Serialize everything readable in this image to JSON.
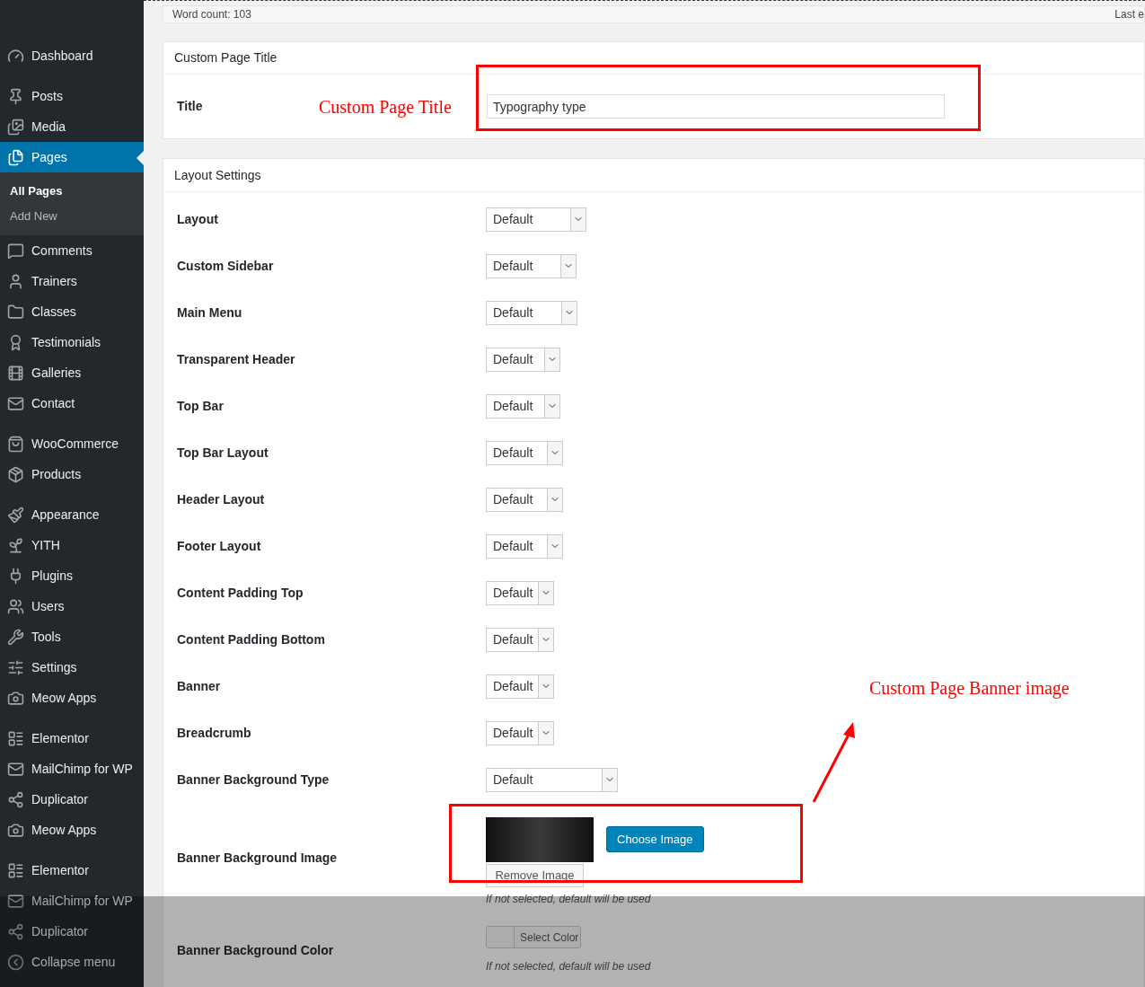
{
  "sidebar": {
    "groups": [
      [
        {
          "label": "Dashboard",
          "selected": false
        }
      ],
      [
        {
          "label": "Posts",
          "selected": false
        },
        {
          "label": "Media",
          "selected": false
        },
        {
          "label": "Pages",
          "selected": true,
          "children": [
            {
              "label": "All Pages",
              "selected": true
            },
            {
              "label": "Add New",
              "selected": false
            }
          ]
        },
        {
          "label": "Comments",
          "selected": false
        },
        {
          "label": "Trainers",
          "selected": false
        },
        {
          "label": "Classes",
          "selected": false
        },
        {
          "label": "Testimonials",
          "selected": false
        },
        {
          "label": "Galleries",
          "selected": false
        },
        {
          "label": "Contact",
          "selected": false
        }
      ],
      [
        {
          "label": "WooCommerce",
          "selected": false
        },
        {
          "label": "Products",
          "selected": false
        }
      ],
      [
        {
          "label": "Appearance",
          "selected": false
        },
        {
          "label": "YITH",
          "selected": false
        },
        {
          "label": "Plugins",
          "selected": false
        },
        {
          "label": "Users",
          "selected": false
        },
        {
          "label": "Tools",
          "selected": false
        },
        {
          "label": "Settings",
          "selected": false
        },
        {
          "label": "Meow Apps",
          "selected": false
        }
      ],
      [
        {
          "label": "Elementor",
          "selected": false
        },
        {
          "label": "MailChimp for WP",
          "selected": false
        },
        {
          "label": "Duplicator",
          "selected": false
        },
        {
          "label": "Meow Apps",
          "selected": false
        }
      ],
      [
        {
          "label": "Elementor",
          "selected": false
        },
        {
          "label": "MailChimp for WP",
          "selected": false
        },
        {
          "label": "Duplicator",
          "selected": false
        },
        {
          "label": "Collapse menu",
          "selected": false
        }
      ]
    ]
  },
  "status_bar": {
    "word_count": "Word count: 103",
    "last_edited": "Last e"
  },
  "custom_page_title": {
    "heading": "Custom Page Title",
    "label": "Title",
    "value": "Typography type"
  },
  "layout_settings": {
    "heading": "Layout Settings",
    "rows": [
      {
        "label": "Layout",
        "value": "Default"
      },
      {
        "label": "Custom Sidebar",
        "value": "Default"
      },
      {
        "label": "Main Menu",
        "value": "Default"
      },
      {
        "label": "Transparent Header",
        "value": "Default"
      },
      {
        "label": "Top Bar",
        "value": "Default"
      },
      {
        "label": "Top Bar Layout",
        "value": "Default"
      },
      {
        "label": "Header Layout",
        "value": "Default"
      },
      {
        "label": "Footer Layout",
        "value": "Default"
      },
      {
        "label": "Content Padding Top",
        "value": "Default"
      },
      {
        "label": "Content Padding Bottom",
        "value": "Default"
      },
      {
        "label": "Banner",
        "value": "Default"
      },
      {
        "label": "Breadcrumb",
        "value": "Default"
      },
      {
        "label": "Banner Background Type",
        "value": "Default"
      }
    ],
    "banner_image": {
      "label": "Banner Background Image",
      "choose_button": "Choose Image",
      "remove_button": "Remove Image",
      "hint": "If not selected, default will be used"
    },
    "banner_color": {
      "label": "Banner Background Color",
      "button": "Select Color",
      "hint": "If not selected, default will be used"
    }
  },
  "annotations": [
    {
      "text": "Custom Page Title"
    },
    {
      "text": "Custom Page Banner image"
    }
  ]
}
